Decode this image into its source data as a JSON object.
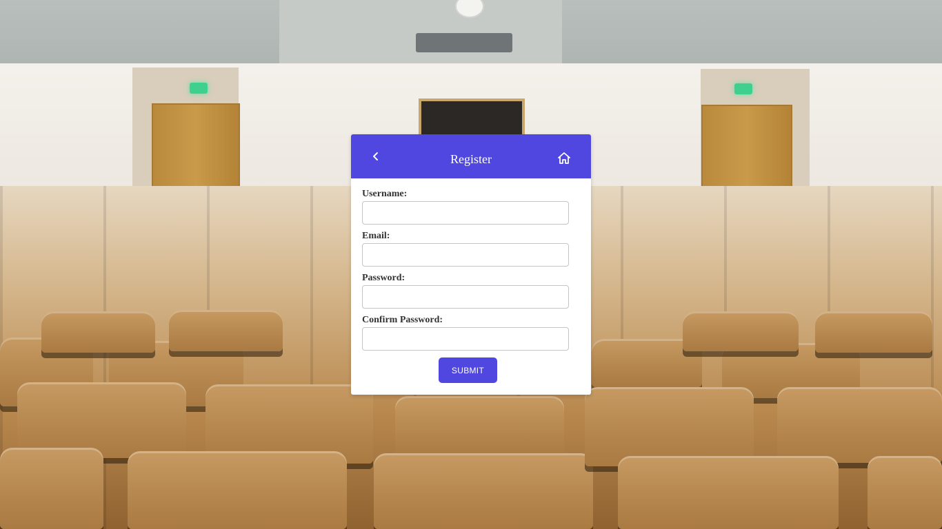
{
  "header": {
    "title": "Register",
    "back_icon": "chevron-left-icon",
    "home_icon": "home-icon"
  },
  "form": {
    "fields": [
      {
        "label": "Username:",
        "value": "",
        "type": "text"
      },
      {
        "label": "Email:",
        "value": "",
        "type": "email"
      },
      {
        "label": "Password:",
        "value": "",
        "type": "password"
      },
      {
        "label": "Confirm Password:",
        "value": "",
        "type": "password"
      }
    ],
    "submit_label": "SUBMIT"
  },
  "colors": {
    "accent": "#5047e0",
    "card_background": "#ffffff",
    "label_text": "#333333",
    "input_border": "#c4c4c4"
  }
}
